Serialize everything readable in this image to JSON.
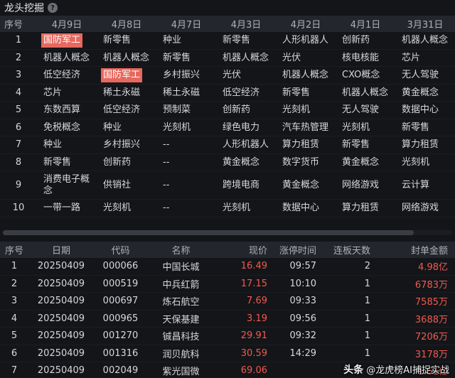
{
  "header": {
    "title": "龙头挖掘",
    "help_icon": "question-circle-icon"
  },
  "top_table": {
    "columns": [
      "序号",
      "4月9日",
      "4月8日",
      "4月7日",
      "4月3日",
      "4月2日",
      "4月1日",
      "3月31日"
    ],
    "rows": [
      {
        "idx": "1",
        "cells": [
          "国防军工",
          "新零售",
          "种业",
          "新零售",
          "人形机器人",
          "创新药",
          "机器人概念"
        ]
      },
      {
        "idx": "2",
        "cells": [
          "机器人概念",
          "机器人概念",
          "新零售",
          "机器人概念",
          "光伏",
          "核电核能",
          "芯片"
        ]
      },
      {
        "idx": "3",
        "cells": [
          "低空经济",
          "国防军工",
          "乡村振兴",
          "光伏",
          "机器人概念",
          "CXO概念",
          "无人驾驶"
        ]
      },
      {
        "idx": "4",
        "cells": [
          "芯片",
          "稀土永磁",
          "稀土永磁",
          "低空经济",
          "新零售",
          "机器人概念",
          "黄金概念"
        ]
      },
      {
        "idx": "5",
        "cells": [
          "东数西算",
          "低空经济",
          "预制菜",
          "创新药",
          "光刻机",
          "无人驾驶",
          "数据中心"
        ]
      },
      {
        "idx": "6",
        "cells": [
          "免税概念",
          "种业",
          "光刻机",
          "绿色电力",
          "汽车热管理",
          "光刻机",
          "新零售"
        ]
      },
      {
        "idx": "7",
        "cells": [
          "种业",
          "乡村振兴",
          "--",
          "人形机器人",
          "算力租赁",
          "新零售",
          "算力租赁"
        ]
      },
      {
        "idx": "8",
        "cells": [
          "新零售",
          "创新药",
          "--",
          "黄金概念",
          "数字货币",
          "黄金概念",
          "光刻机"
        ]
      },
      {
        "idx": "9",
        "cells": [
          "消费电子概念",
          "供销社",
          "--",
          "跨境电商",
          "黄金概念",
          "网络游戏",
          "云计算"
        ]
      },
      {
        "idx": "10",
        "cells": [
          "一带一路",
          "光刻机",
          "--",
          "光刻机",
          "数据中心",
          "算力租赁",
          "网络游戏"
        ]
      }
    ],
    "highlight_color": "#e7685e"
  },
  "bottom_table": {
    "columns": [
      "序号",
      "日期",
      "代码",
      "名称",
      "现价",
      "涨停时间",
      "连板天数",
      "封单金额"
    ],
    "rows": [
      {
        "idx": "1",
        "date": "20250409",
        "code": "000066",
        "name": "中国长城",
        "price": "16.49",
        "time": "09:57",
        "days": "2",
        "amount": "4.98亿"
      },
      {
        "idx": "2",
        "date": "20250409",
        "code": "000519",
        "name": "中兵红箭",
        "price": "17.15",
        "time": "10:10",
        "days": "1",
        "amount": "6783万"
      },
      {
        "idx": "3",
        "date": "20250409",
        "code": "000697",
        "name": "炼石航空",
        "price": "7.69",
        "time": "09:33",
        "days": "1",
        "amount": "7585万"
      },
      {
        "idx": "4",
        "date": "20250409",
        "code": "000965",
        "name": "天保基建",
        "price": "3.19",
        "time": "09:56",
        "days": "1",
        "amount": "3688万"
      },
      {
        "idx": "5",
        "date": "20250409",
        "code": "001270",
        "name": "铖昌科技",
        "price": "29.91",
        "time": "09:32",
        "days": "1",
        "amount": "7206万"
      },
      {
        "idx": "6",
        "date": "20250409",
        "code": "001316",
        "name": "润贝航科",
        "price": "30.59",
        "time": "14:29",
        "days": "1",
        "amount": "3178万"
      },
      {
        "idx": "7",
        "date": "20250409",
        "code": "002049",
        "name": "紫光国微",
        "price": "69.06",
        "time": "",
        "days": "",
        "amount": "1.51亿"
      }
    ],
    "up_color": "#f25a4e"
  },
  "watermark": {
    "logo": "头条",
    "text": "@龙虎榜AI捕捉实战"
  }
}
